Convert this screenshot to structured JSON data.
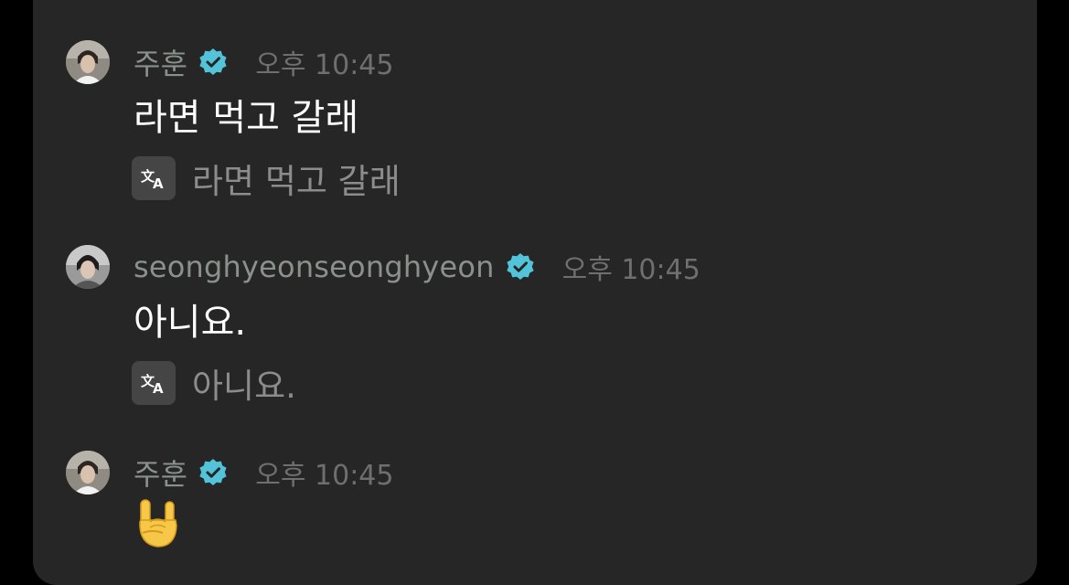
{
  "messages": [
    {
      "username": "주훈",
      "verified_icon": "verified-badge-icon",
      "timestamp": "오후 10:45",
      "text": "라면 먹고 갈래",
      "translation_icon": "translate-icon",
      "translation": "라면 먹고 갈래"
    },
    {
      "username": "seonghyeonseonghyeon",
      "verified_icon": "verified-badge-icon",
      "timestamp": "오후 10:45",
      "text": "아니요.",
      "translation_icon": "translate-icon",
      "translation": "아니요."
    },
    {
      "username": "주훈",
      "verified_icon": "verified-badge-icon",
      "timestamp": "오후 10:45",
      "emoji_icon": "rock-on-hand-emoji"
    }
  ],
  "colors": {
    "panel_background": "#262626",
    "verified_badge": "#52c3d9",
    "username": "#8a918b",
    "timestamp": "#6f6f6f",
    "translation_text": "#8c8c8c"
  }
}
